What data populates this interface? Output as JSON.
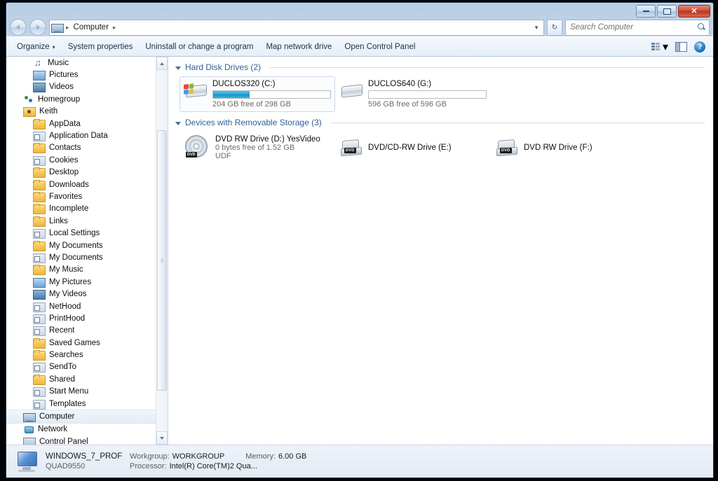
{
  "window": {
    "controls": {
      "minimize": "–",
      "maximize": "□",
      "close": "✕"
    }
  },
  "address": {
    "crumb_root": "Computer",
    "sep": "▸",
    "dropdown": "▼",
    "refresh_icon": "refresh-icon",
    "back_icon": "back-arrow-icon",
    "forward_icon": "forward-arrow-icon"
  },
  "search": {
    "placeholder": "Search Computer",
    "value": "",
    "icon": "search-icon"
  },
  "toolbar": {
    "organize": "Organize",
    "organize_caret": "▾",
    "system_properties": "System properties",
    "uninstall": "Uninstall or change a program",
    "map_drive": "Map network drive",
    "control_panel": "Open Control Panel",
    "view_caret": "▾",
    "help": "?"
  },
  "sidebar": {
    "items": [
      {
        "label": "Music",
        "icon": "music-icon",
        "indent": 2,
        "selected": false
      },
      {
        "label": "Pictures",
        "icon": "pictures-icon",
        "indent": 2,
        "selected": false
      },
      {
        "label": "Videos",
        "icon": "videos-icon",
        "indent": 2,
        "selected": false
      },
      {
        "label": "Homegroup",
        "icon": "homegroup-icon",
        "indent": 1,
        "selected": false
      },
      {
        "label": "Keith",
        "icon": "user-folder-icon",
        "indent": 1,
        "selected": false
      },
      {
        "label": "AppData",
        "icon": "folder-icon",
        "indent": 2,
        "selected": false
      },
      {
        "label": "Application Data",
        "icon": "junction-icon",
        "indent": 2,
        "selected": false
      },
      {
        "label": "Contacts",
        "icon": "contacts-folder-icon",
        "indent": 2,
        "selected": false
      },
      {
        "label": "Cookies",
        "icon": "junction-icon",
        "indent": 2,
        "selected": false
      },
      {
        "label": "Desktop",
        "icon": "desktop-folder-icon",
        "indent": 2,
        "selected": false
      },
      {
        "label": "Downloads",
        "icon": "downloads-folder-icon",
        "indent": 2,
        "selected": false
      },
      {
        "label": "Favorites",
        "icon": "favorites-folder-icon",
        "indent": 2,
        "selected": false
      },
      {
        "label": "Incomplete",
        "icon": "folder-icon",
        "indent": 2,
        "selected": false
      },
      {
        "label": "Links",
        "icon": "links-folder-icon",
        "indent": 2,
        "selected": false
      },
      {
        "label": "Local Settings",
        "icon": "junction-icon",
        "indent": 2,
        "selected": false
      },
      {
        "label": "My Documents",
        "icon": "documents-folder-icon",
        "indent": 2,
        "selected": false
      },
      {
        "label": "My Documents",
        "icon": "junction-icon",
        "indent": 2,
        "selected": false
      },
      {
        "label": "My Music",
        "icon": "music-folder-icon",
        "indent": 2,
        "selected": false
      },
      {
        "label": "My Pictures",
        "icon": "pictures-folder-icon",
        "indent": 2,
        "selected": false
      },
      {
        "label": "My Videos",
        "icon": "videos-folder-icon",
        "indent": 2,
        "selected": false
      },
      {
        "label": "NetHood",
        "icon": "junction-icon",
        "indent": 2,
        "selected": false
      },
      {
        "label": "PrintHood",
        "icon": "junction-icon",
        "indent": 2,
        "selected": false
      },
      {
        "label": "Recent",
        "icon": "junction-icon",
        "indent": 2,
        "selected": false
      },
      {
        "label": "Saved Games",
        "icon": "saved-games-folder-icon",
        "indent": 2,
        "selected": false
      },
      {
        "label": "Searches",
        "icon": "searches-folder-icon",
        "indent": 2,
        "selected": false
      },
      {
        "label": "SendTo",
        "icon": "junction-icon",
        "indent": 2,
        "selected": false
      },
      {
        "label": "Shared",
        "icon": "folder-icon",
        "indent": 2,
        "selected": false
      },
      {
        "label": "Start Menu",
        "icon": "junction-icon",
        "indent": 2,
        "selected": false
      },
      {
        "label": "Templates",
        "icon": "junction-icon",
        "indent": 2,
        "selected": false
      },
      {
        "label": "Computer",
        "icon": "computer-icon",
        "indent": 1,
        "selected": true
      },
      {
        "label": "Network",
        "icon": "network-icon",
        "indent": 1,
        "selected": false
      },
      {
        "label": "Control Panel",
        "icon": "control-panel-icon",
        "indent": 1,
        "selected": false
      }
    ]
  },
  "content": {
    "groups": [
      {
        "title": "Hard Disk Drives (2)",
        "kind": "hdd",
        "items": [
          {
            "name": "DUCLOS320 (C:)",
            "capacity_text": "204 GB free of 298 GB",
            "free_gb": 204,
            "total_gb": 298,
            "used_percent": 31,
            "icon": "hard-drive-windows-icon",
            "selected": true,
            "has_bar": true
          },
          {
            "name": "DUCLOS640 (G:)",
            "capacity_text": "596 GB free of 596 GB",
            "free_gb": 596,
            "total_gb": 596,
            "used_percent": 0,
            "icon": "hard-drive-icon",
            "selected": false,
            "has_bar": true
          }
        ]
      },
      {
        "title": "Devices with Removable Storage (3)",
        "kind": "optical",
        "items": [
          {
            "name": "DVD RW Drive (D:) YesVideo",
            "capacity_text": "0 bytes free of 1.52 GB",
            "filesystem": "UDF",
            "icon": "dvd-disc-icon",
            "badge": "DVD",
            "selected": false,
            "has_media": true
          },
          {
            "name": "DVD/CD-RW Drive (E:)",
            "capacity_text": "",
            "filesystem": "",
            "icon": "dvd-drive-icon",
            "badge": "DVD",
            "selected": false,
            "has_media": false
          },
          {
            "name": "DVD RW Drive (F:)",
            "capacity_text": "",
            "filesystem": "",
            "icon": "dvd-drive-icon",
            "badge": "DVD",
            "selected": false,
            "has_media": false
          }
        ]
      }
    ]
  },
  "details_pane": {
    "computer_name": "WINDOWS_7_PROF",
    "model": "QUAD9550",
    "workgroup_label": "Workgroup:",
    "workgroup_value": "WORKGROUP",
    "processor_label": "Processor:",
    "processor_value": "Intel(R) Core(TM)2 Qua...",
    "memory_label": "Memory:",
    "memory_value": "6.00 GB",
    "icon": "computer-details-icon"
  },
  "colors": {
    "accent_blue": "#2f6096",
    "bar_fill": "#23a8d8",
    "close_red": "#cf4f38",
    "selection": "#e2ecf6"
  }
}
